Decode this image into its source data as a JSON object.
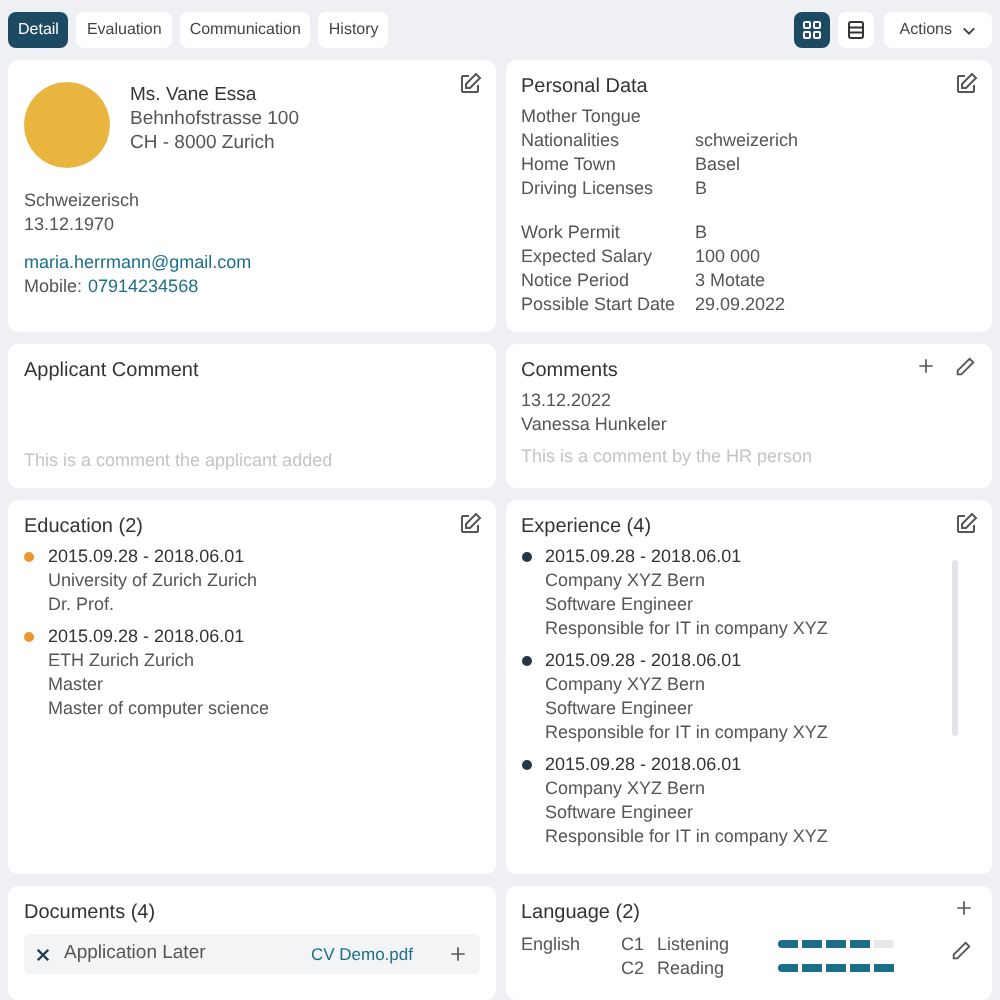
{
  "tabs": [
    {
      "label": "Detail",
      "selected": true
    },
    {
      "label": "Evaluation",
      "selected": false
    },
    {
      "label": "Communication",
      "selected": false
    },
    {
      "label": "History",
      "selected": false
    }
  ],
  "view_toggle": [
    {
      "kind": "grid",
      "selected": true
    },
    {
      "kind": "list",
      "selected": false
    }
  ],
  "actions_button": {
    "label": "Actions"
  },
  "profile": {
    "name": "Ms. Vane Essa",
    "address": [
      "Behnhofstrasse 100",
      "CH - 8000 Zurich"
    ],
    "nationality": "Schweizerisch",
    "birth_date": "13.12.1970",
    "email": "maria.herrmann@gmail.com",
    "mobile_label": "Mobile:",
    "mobile": "07914234568"
  },
  "personal_data": {
    "title": "Personal Data",
    "groups": [
      [
        {
          "label": "Mother Tongue"
        },
        {
          "label": "Nationalities",
          "value": "schweizerich"
        },
        {
          "label": "Home Town",
          "value": "Basel"
        },
        {
          "label": "Driving Licenses",
          "value": "B"
        }
      ],
      [
        {
          "label": "Work Permit",
          "value": "B"
        },
        {
          "label": "Expected Salary",
          "value": "100 000"
        },
        {
          "label": "Notice Period",
          "value": "3 Motate"
        },
        {
          "label": "Possible Start Date",
          "value": "29.09.2022"
        }
      ]
    ]
  },
  "applicant_comment": {
    "title": "Applicant Comment",
    "text": "This is a comment the applicant added"
  },
  "comments": {
    "title": "Comments",
    "date": "13.12.2022",
    "author": "Vanessa Hunkeler",
    "text": "This is a comment by the HR person"
  },
  "education": {
    "title": "Education (2)",
    "items": [
      {
        "dates": "2015.09.28 - 2018.06.01",
        "lines": [
          "University of Zurich Zurich",
          "Dr. Prof."
        ]
      },
      {
        "dates": "2015.09.28 - 2018.06.01",
        "lines": [
          "ETH Zurich Zurich",
          "Master",
          "Master of computer science"
        ]
      }
    ]
  },
  "experience": {
    "title": "Experience (4)",
    "items": [
      {
        "dates": "2015.09.28 - 2018.06.01",
        "lines": [
          "Company XYZ Bern",
          "Software Engineer",
          "Responsible for IT in company XYZ"
        ]
      },
      {
        "dates": "2015.09.28 - 2018.06.01",
        "lines": [
          "Company XYZ Bern",
          "Software Engineer",
          "Responsible for IT in company XYZ"
        ]
      },
      {
        "dates": "2015.09.28 - 2018.06.01",
        "lines": [
          "Company XYZ Bern",
          "Software Engineer",
          "Responsible for IT in company XYZ"
        ]
      }
    ]
  },
  "documents": {
    "title": "Documents (4)",
    "items": [
      {
        "name": "Application Later",
        "file": "CV Demo.pdf"
      }
    ]
  },
  "language": {
    "title": "Language (2)",
    "items": [
      {
        "language": "English",
        "skills": [
          {
            "grade": "C1",
            "skill": "Listening",
            "level": 0.8
          },
          {
            "grade": "C2",
            "skill": "Reading",
            "level": 1
          }
        ]
      }
    ]
  }
}
